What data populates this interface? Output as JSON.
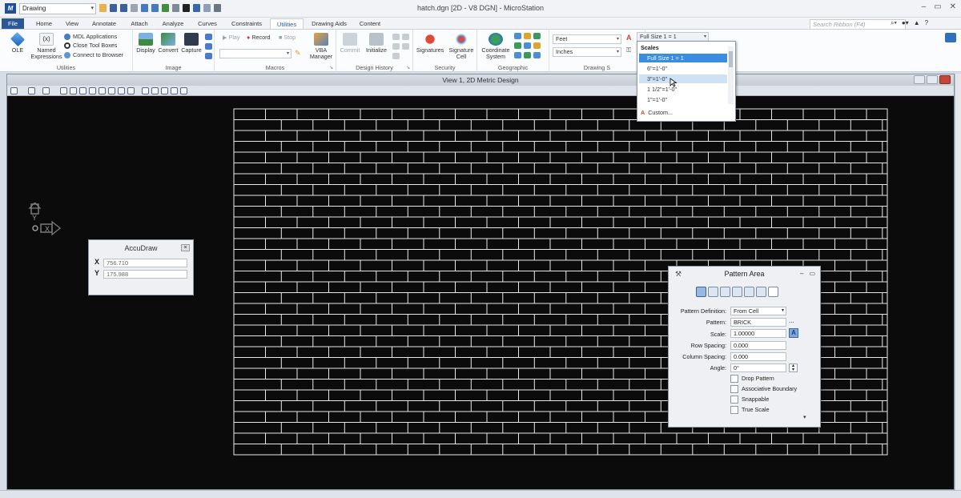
{
  "title_bar": {
    "workflow": "Drawing",
    "window_title": "hatch.dgn [2D - V8 DGN] - MicroStation",
    "search_placeholder": "Search Ribbon (F4)"
  },
  "tabs": [
    "File",
    "Home",
    "View",
    "Annotate",
    "Attach",
    "Analyze",
    "Curves",
    "Constraints",
    "Utilities",
    "Drawing Aids",
    "Content"
  ],
  "active_tab": "Utilities",
  "ribbon": {
    "utilities": {
      "label": "Utilities",
      "ole": "OLE",
      "named_expressions": "Named Expressions",
      "expr_icon": "(x)",
      "mdl": "MDL Applications",
      "close_tool_boxes": "Close Tool Boxes",
      "connect": "Connect to Browser"
    },
    "image": {
      "label": "Image",
      "display": "Display",
      "convert": "Convert",
      "capture": "Capture"
    },
    "macros": {
      "label": "Macros",
      "play": "Play",
      "record": "Record",
      "stop": "Stop",
      "vba": "VBA Manager"
    },
    "design_history": {
      "label": "Design History",
      "commit": "Commit",
      "initialize": "Initialize"
    },
    "security": {
      "label": "Security",
      "signatures": "Signatures",
      "signature_cell": "Signature Cell"
    },
    "geographic": {
      "label": "Geographic",
      "coordinate_system": "Coordinate System"
    },
    "drawing_scale": {
      "label": "Drawing S",
      "master_units": "Feet",
      "sub_units": "Inches",
      "scale": "Full Size 1 = 1"
    }
  },
  "scales_dropdown": {
    "header": "Scales",
    "items": [
      "Full Size 1 = 1",
      "6\"=1'-0\"",
      "3\"=1'-0\"",
      "1 1/2\"=1'-0\"",
      "1\"=1'-0\""
    ],
    "selected_index": 0,
    "hover_index": 2,
    "custom": "Custom..."
  },
  "view": {
    "title": "View 1, 2D Metric Design",
    "background": "#0b0b0b",
    "brick_color": "#e8e8e8"
  },
  "accudraw": {
    "title": "AccuDraw",
    "x_label": "X",
    "x_value": "756.710",
    "y_label": "Y",
    "y_value": "175.988"
  },
  "pattern_area": {
    "title": "Pattern Area",
    "fields": [
      {
        "label": "Pattern Definition:",
        "value": "From Cell"
      },
      {
        "label": "Pattern:",
        "value": "BRICK"
      },
      {
        "label": "Scale:",
        "value": "1.00000"
      },
      {
        "label": "Row Spacing:",
        "value": "0.000"
      },
      {
        "label": "Column Spacing:",
        "value": "0.000"
      },
      {
        "label": "Angle:",
        "value": "0°"
      }
    ],
    "pattern_browse": "...",
    "checkboxes": [
      "Drop Pattern",
      "Associative Boundary",
      "Snappable",
      "True Scale"
    ]
  },
  "colors": {
    "accent": "#2b5797",
    "selection": "#3b8de0"
  }
}
